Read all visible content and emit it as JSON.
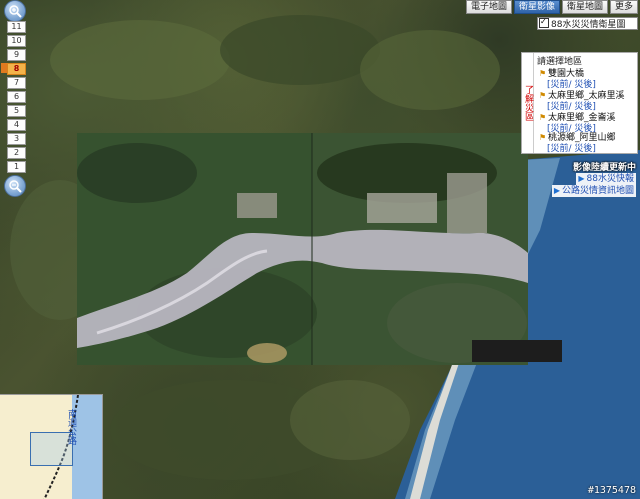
{
  "map_tabs": [
    {
      "label": "電子地圖",
      "active": false
    },
    {
      "label": "衛星影像",
      "active": true
    },
    {
      "label": "衛星地圖",
      "active": false
    },
    {
      "label": "更多",
      "active": false
    }
  ],
  "overlay": {
    "label": "88水災災情衛星圖",
    "checked": true
  },
  "zoom": {
    "levels": [
      "11",
      "10",
      "9",
      "8",
      "7",
      "6",
      "5",
      "4",
      "3",
      "2",
      "1"
    ],
    "current": "8"
  },
  "side_panel": {
    "tab_label": "了解災區",
    "title": "請選擇地區",
    "locations": [
      {
        "name": "雙園大橋",
        "links": "[災前/ 災後]"
      },
      {
        "name": "太麻里鄉_太麻里溪",
        "links": "[災前/ 災後]"
      },
      {
        "name": "太麻里鄉_金崙溪",
        "links": "[災前/ 災後]"
      },
      {
        "name": "桃源鄉_阿里山鄉",
        "links": "[災前/ 災後]"
      }
    ]
  },
  "updating_text": "影像陸續更新中",
  "links": [
    "88水災快報",
    "公路災情資訊地圖"
  ],
  "overview_map": {
    "road_label": "南迴公路"
  },
  "watermark": "#1375478",
  "colors": {
    "active_tab": "#2f63a8",
    "current_zoom": "#f3b34a",
    "link": "#1f4fb3",
    "panel_tab_text": "#d10000"
  }
}
